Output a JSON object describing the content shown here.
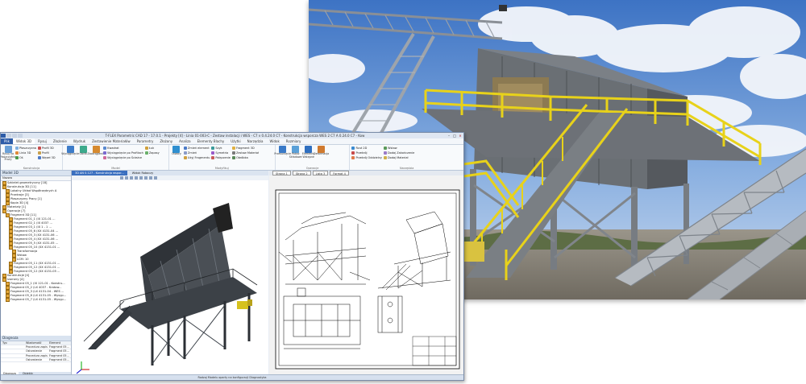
{
  "cad_window": {
    "title": "T-FLEX Parametric CAD 17 - 17.0.1 - Projekty [4] - Linia 01-003-C - Zestaw instalacji i WES - C7 v 0.4.24.0 C7 - Konstrukcja wsporcza WES 2 C7 A 0.24.0 C7 - Kow",
    "tabs": [
      "Plik",
      "Widok 3D",
      "Rysuj",
      "Złożenie",
      "Wydruk",
      "Zestawienie Materiałów",
      "Parametry",
      "Złożony",
      "Analiza",
      "Elementy Blachy",
      "Użytki",
      "Narzędzia",
      "Widok",
      "Rozmiary"
    ],
    "ribbon_groups": [
      {
        "label": "Konstrukcja",
        "buttons": [
          "Rysuj na Płaszczyźnie Pracy",
          "Płaszczyzna",
          "Profil 3D",
          "Linia 3D",
          "Oś",
          "Profil",
          "Węzeł 3D"
        ]
      },
      {
        "label": "Model",
        "buttons": [
          "Wyciągnięcie",
          "Obrót",
          "Zaokrąglenie",
          "Kwadrat",
          "Wyciągnięcie po Profilach",
          "Wyciągnięcie po Ścieżce",
          "Łuk",
          "Zapasy"
        ]
      },
      {
        "label": "Modyfikuj",
        "buttons": [
          "Otwory",
          "Zmień element",
          "Zmień",
          "Użyj Fragmentu",
          "Szyk",
          "Symetria",
          "Połączenie",
          "Fragment 3D",
          "Zestaw Materiał",
          "Obróbka"
        ]
      },
      {
        "label": "Operacje",
        "buttons": [
          "Przesunięcie",
          "Pokaż Składowe",
          "Elementy Wstępne",
          "Deformacja"
        ]
      },
      {
        "label": "Narzędzia",
        "buttons": [
          "Rzut 2D",
          "Przekrój",
          "Przekrój Oddzielny",
          "Wstaw",
          "Dodaj Zakończenie",
          "Dodaj Materiał"
        ]
      }
    ],
    "model_panel": {
      "title": "Model 3D",
      "search_label": "Nazwa",
      "tree": [
        {
          "text": "Szkielet geometryczny [18]",
          "indent": 0
        },
        {
          "text": "Konstrukcja 3D [11]",
          "indent": 0
        },
        {
          "text": "Lokalny Układ Współrzędnych A",
          "indent": 1
        },
        {
          "text": "Przekroje [3]",
          "indent": 1
        },
        {
          "text": "Płaszczyzny Pracy [1]",
          "indent": 1
        },
        {
          "text": "Kopia 3D [4]",
          "indent": 1
        },
        {
          "text": "Materiały [1]",
          "indent": 0
        },
        {
          "text": "Operacje [7]",
          "indent": 0
        },
        {
          "text": "Fragment 3D [11]",
          "indent": 1
        },
        {
          "text": "Fragment 01_1 (IX 121-01 ...",
          "indent": 2
        },
        {
          "text": "Fragment 02_1 (IX 4037 ...",
          "indent": 2
        },
        {
          "text": "Fragment 03_1 (IX 1 - 1 ...",
          "indent": 2
        },
        {
          "text": "Fragment 05_6 (XX 4131-04 ...",
          "indent": 2
        },
        {
          "text": "Fragment 05_3 (XX 4131-06 ...",
          "indent": 2
        },
        {
          "text": "Fragment 05_4 (XX 4131-06 ...",
          "indent": 2
        },
        {
          "text": "Fragment 05_5 (XX 4131-05 ...",
          "indent": 2
        },
        {
          "text": "Fragment 05_10 (XX 4131-01 ...",
          "indent": 2
        },
        {
          "text": "Transformacja",
          "indent": 3
        },
        {
          "text": "Wstaw",
          "indent": 3
        },
        {
          "text": "LCM: 10",
          "indent": 3
        },
        {
          "text": "Fragment 05_11 (XX 4131-01 ...",
          "indent": 2
        },
        {
          "text": "Fragment 05_12 (XX 4131-01 ...",
          "indent": 2
        },
        {
          "text": "Fragment 05_12 (XX 4131-05 ...",
          "indent": 2
        },
        {
          "text": "Konstrukcje [4]",
          "indent": 0
        },
        {
          "text": "Izomery [4]",
          "indent": 0
        },
        {
          "text": "Fragment 05_1 (IX 121-01 - Konstru...",
          "indent": 1
        },
        {
          "text": "Fragment 05_2 (LX 4037 - Kratow...",
          "indent": 1
        },
        {
          "text": "Fragment 05_3 (LX 4131-04 - WES ...",
          "indent": 1
        },
        {
          "text": "Fragment 05_6 (LX 4131-05 - Wysyp...",
          "indent": 1
        },
        {
          "text": "Fragment 05_7 (LX 4131-05 - Wysyp...",
          "indent": 1
        }
      ]
    },
    "diag_panel": {
      "title": "Diagnoza",
      "headers": [
        "Typ",
        "Wiadomość",
        "Element"
      ],
      "rows": [
        [
          "",
          "Procedura zapis...",
          "Fragment 05..."
        ],
        [
          "",
          "Ostrzeżenie",
          "Fragment 05..."
        ],
        [
          "",
          "Procedura zapis...",
          "Fragment 05..."
        ],
        [
          "",
          "Ostrzeżenie",
          "Fragment 05..."
        ]
      ],
      "footer_tabs": [
        "Diagnoza",
        "Obiekty"
      ]
    },
    "view3d_tabs": [
      "3D AN 0.127 - Konstrukcja wspor...",
      "Widok Roboczy"
    ],
    "sheet_tabs": [
      "Strona 1",
      "Strona 2",
      "Lista 3",
      "Format 4"
    ],
    "status_text": "Rodzaj Modelu oparty na konfiguracji Diagnostyka"
  }
}
